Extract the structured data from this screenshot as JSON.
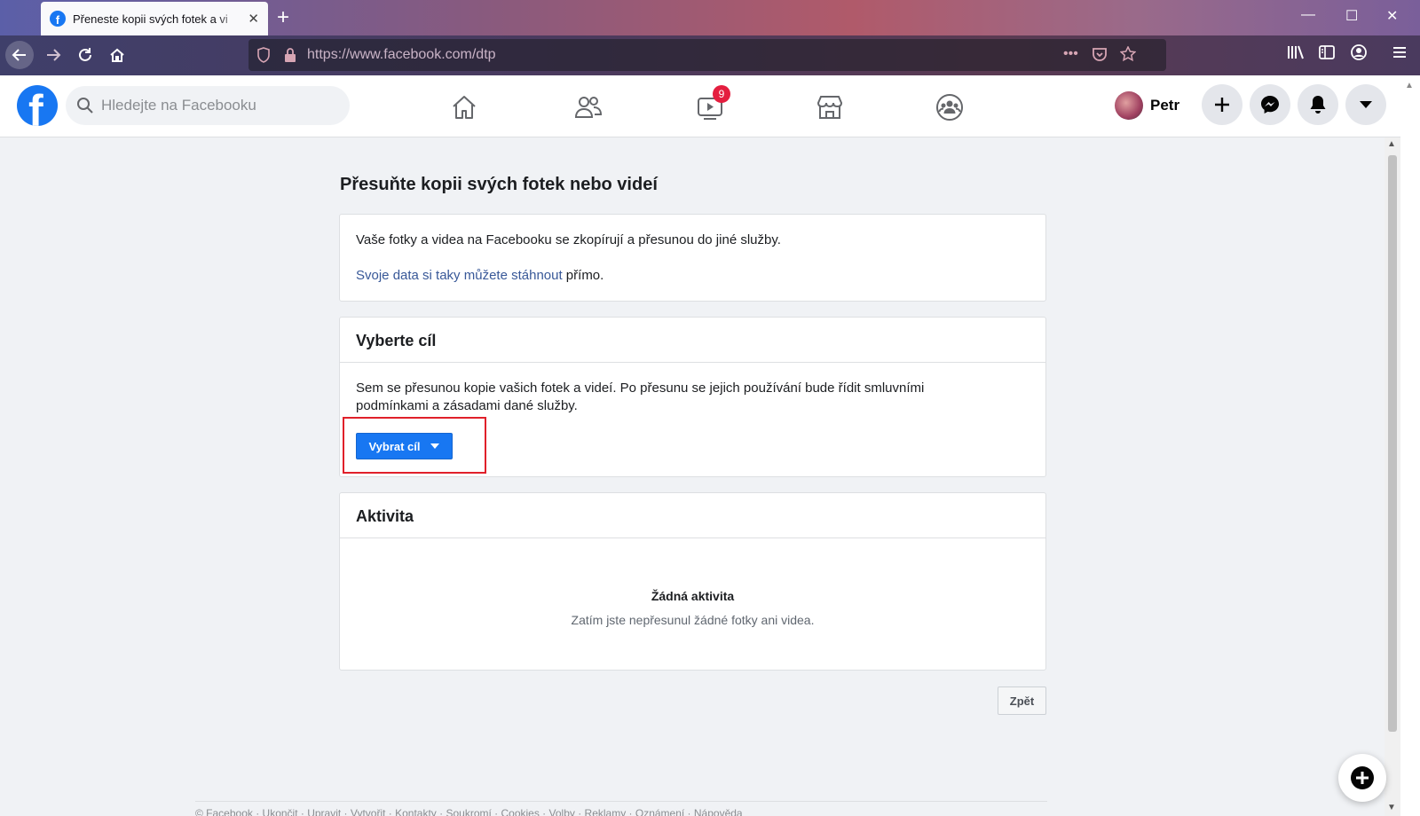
{
  "browser": {
    "tab_title": "Přeneste kopii svých fotek a vi",
    "tab_close": "✕",
    "new_tab": "+",
    "url": "https://www.facebook.com/dtp",
    "minimize": "—",
    "maximize": "☐",
    "close": "✕",
    "more": "•••"
  },
  "header": {
    "search_placeholder": "Hledejte na Facebooku",
    "watch_badge": "9",
    "profile_name": "Petr",
    "brand_color": "#1877f2"
  },
  "main": {
    "title": "Přesuňte kopii svých fotek nebo videí",
    "intro_card": {
      "text": "Vaše fotky a videa na Facebooku se zkopírují a přesunou do jiné služby.",
      "link": "Svoje data si taky můžete stáhnout",
      "link_suffix": " přímo."
    },
    "destination_card": {
      "heading": "Vyberte cíl",
      "text": "Sem se přesunou kopie vašich fotek a videí. Po přesunu se jejich používání bude řídit smluvními podmínkami a zásadami dané služby.",
      "button": "Vybrat cíl"
    },
    "activity_card": {
      "heading": "Aktivita",
      "empty_title": "Žádná aktivita",
      "empty_text": "Zatím jste nepřesunul žádné fotky ani videa."
    },
    "back_button": "Zpět"
  },
  "footer": {
    "text": "© Facebook · Ukončit · Upravit · Vytvořit · Kontakty · Soukromí · Cookies · Volby · Reklamy · Oznámení · Nápověda"
  }
}
